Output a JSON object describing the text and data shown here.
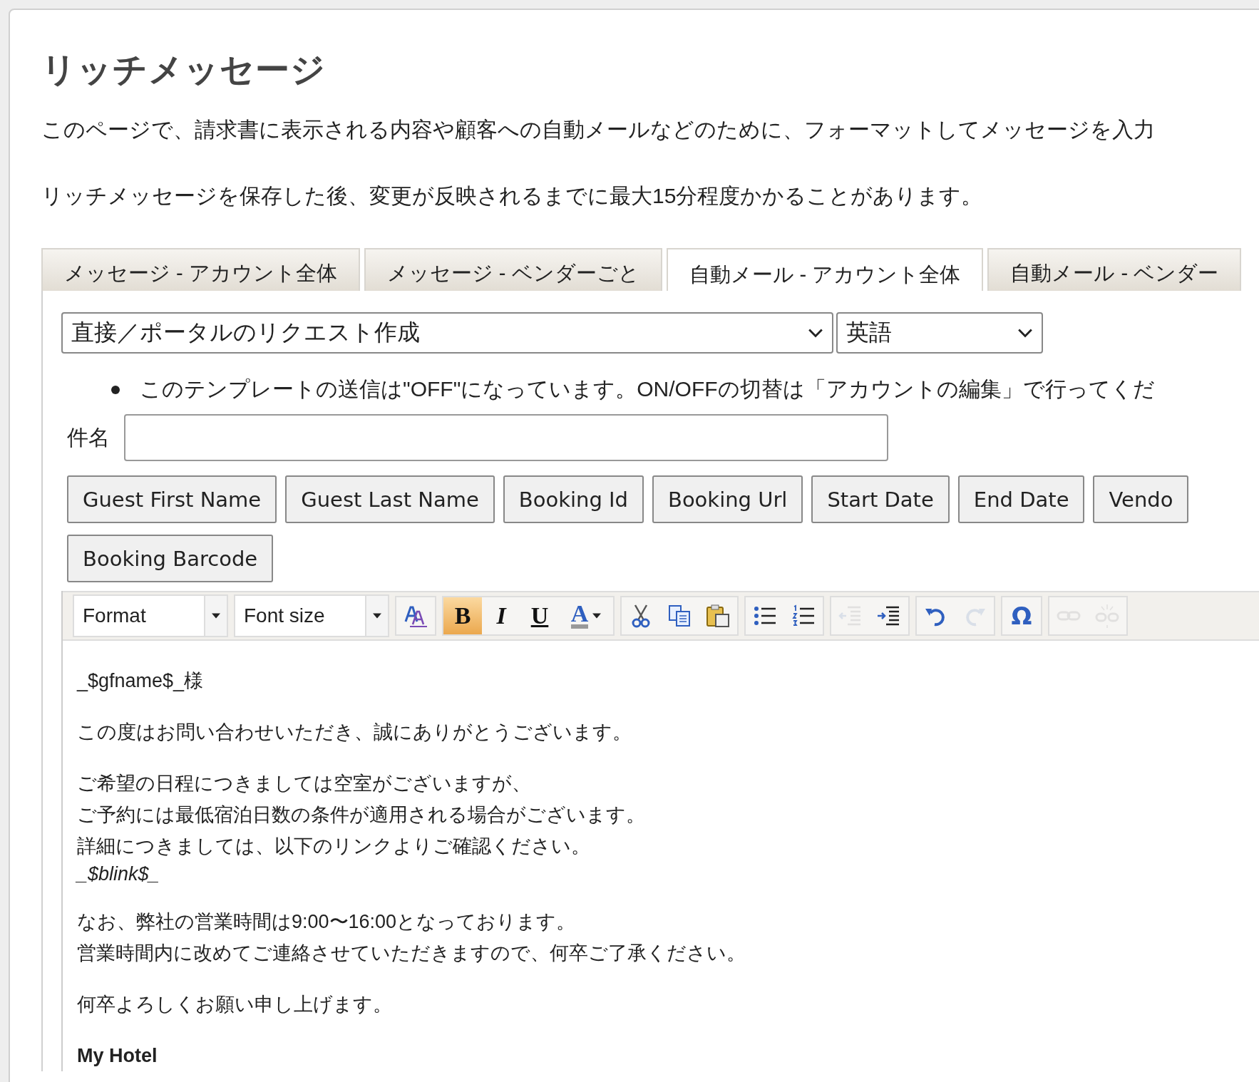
{
  "title": "リッチメッセージ",
  "intro": [
    "このページで、請求書に表示される内容や顧客への自動メールなどのために、フォーマットしてメッセージを入力",
    "リッチメッセージを保存した後、変更が反映されるまでに最大15分程度かかることがあります。"
  ],
  "tabs": [
    {
      "label": "メッセージ - アカウント全体",
      "selected": false
    },
    {
      "label": "メッセージ - ベンダーごと",
      "selected": false
    },
    {
      "label": "自動メール - アカウント全体",
      "selected": true
    },
    {
      "label": "自動メール - ベンダー",
      "selected": false
    }
  ],
  "template_select": {
    "value": "直接／ポータルのリクエスト作成"
  },
  "language_select": {
    "value": "英語"
  },
  "notice": "このテンプレートの送信は\"OFF\"になっています。ON/OFFの切替は「アカウントの編集」で行ってくだ",
  "subject": {
    "label": "件名"
  },
  "placeholder_buttons": [
    [
      "Guest First Name",
      "Guest Last Name",
      "Booking Id",
      "Booking Url",
      "Start Date",
      "End Date",
      "Vendo"
    ],
    [
      "Booking Barcode"
    ]
  ],
  "toolbar": {
    "combos": [
      {
        "label": "Format"
      },
      {
        "label": "Font size"
      }
    ],
    "groups": [
      [
        {
          "kind": "styles",
          "active": false,
          "disabled": false
        }
      ],
      [
        {
          "kind": "bold",
          "label": "B",
          "active": true,
          "disabled": false
        },
        {
          "kind": "italic",
          "label": "I",
          "active": false,
          "disabled": false
        },
        {
          "kind": "underline",
          "label": "U",
          "active": false,
          "disabled": false
        },
        {
          "kind": "color",
          "label": "A",
          "active": false,
          "disabled": false
        }
      ],
      [
        {
          "kind": "cut",
          "active": false,
          "disabled": false
        },
        {
          "kind": "copy",
          "active": false,
          "disabled": false
        },
        {
          "kind": "paste",
          "active": false,
          "disabled": false
        }
      ],
      [
        {
          "kind": "bullets",
          "active": false,
          "disabled": false
        },
        {
          "kind": "numbers",
          "active": false,
          "disabled": false
        }
      ],
      [
        {
          "kind": "outdent",
          "active": false,
          "disabled": true
        },
        {
          "kind": "indent",
          "active": false,
          "disabled": false
        }
      ],
      [
        {
          "kind": "undo",
          "active": false,
          "disabled": false
        },
        {
          "kind": "redo",
          "active": false,
          "disabled": true
        }
      ],
      [
        {
          "kind": "symbol",
          "label": "Ω",
          "active": false,
          "disabled": false
        }
      ],
      [
        {
          "kind": "link",
          "active": false,
          "disabled": true
        },
        {
          "kind": "unlink",
          "active": false,
          "disabled": true
        }
      ]
    ]
  },
  "body": [
    {
      "kind": "plain",
      "lines": [
        {
          "text": "_$gfname$_様",
          "italic": false
        }
      ]
    },
    {
      "kind": "plain",
      "lines": [
        {
          "text": "この度はお問い合わせいただき、誠にありがとうございます。",
          "italic": false
        }
      ]
    },
    {
      "kind": "plain",
      "lines": [
        {
          "text": "ご希望の日程につきましては空室がございますが、",
          "italic": false
        },
        {
          "text": "ご予約には最低宿泊日数の条件が適用される場合がございます。",
          "italic": false
        },
        {
          "text": "詳細につきましては、以下のリンクよりご確認ください。",
          "italic": false
        },
        {
          "text": "_$blink$_",
          "italic": true
        }
      ]
    },
    {
      "kind": "plain",
      "lines": [
        {
          "text": "なお、弊社の営業時間は9:00〜16:00となっております。",
          "italic": false
        },
        {
          "text": "営業時間内に改めてご連絡させていただきますので、何卒ご了承ください。",
          "italic": false
        }
      ]
    },
    {
      "kind": "plain",
      "lines": [
        {
          "text": "何卒よろしくお願い申し上げます。",
          "italic": false
        }
      ]
    },
    {
      "kind": "strong",
      "lines": [
        {
          "text": "My Hotel",
          "italic": false
        }
      ]
    }
  ]
}
